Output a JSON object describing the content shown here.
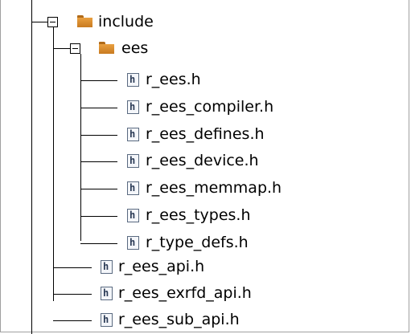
{
  "tree": {
    "folders": [
      {
        "id": "include",
        "name": "include",
        "expanded": true
      },
      {
        "id": "ees",
        "name": "ees",
        "expanded": true
      }
    ],
    "ees_files": [
      "r_ees.h",
      "r_ees_compiler.h",
      "r_ees_defines.h",
      "r_ees_device.h",
      "r_ees_memmap.h",
      "r_ees_types.h",
      "r_type_defs.h"
    ],
    "include_files": [
      "r_ees_api.h",
      "r_ees_exrfd_api.h",
      "r_ees_sub_api.h"
    ],
    "file_icon_glyph": "h",
    "colors": {
      "folder": "#e29434",
      "connector": "#000000",
      "icon_border": "#5a6a80"
    }
  }
}
